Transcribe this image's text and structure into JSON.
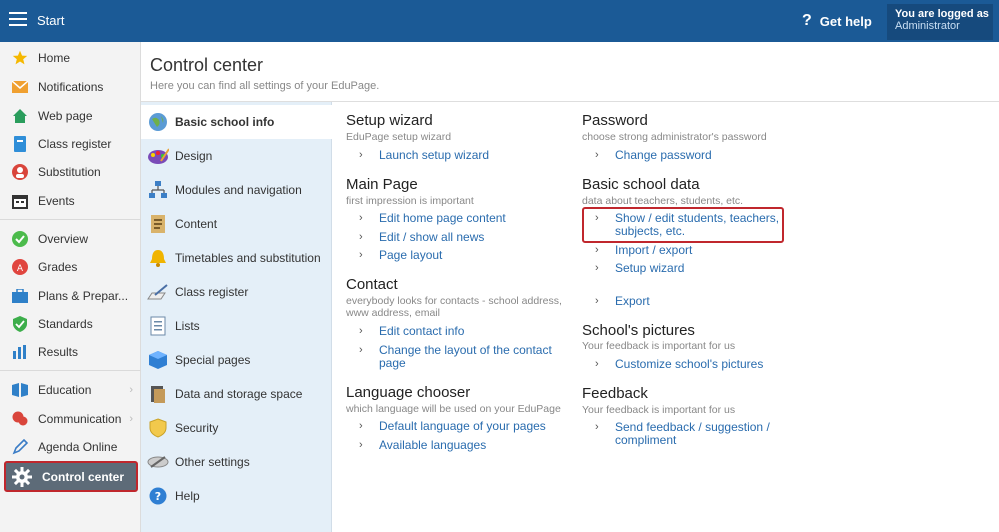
{
  "topbar": {
    "title": "Start",
    "help_label": "Get help",
    "login_line1": "You are logged as",
    "login_line2": "Administrator"
  },
  "sidebar": {
    "items": [
      {
        "label": "Home",
        "icon": "star-icon"
      },
      {
        "label": "Notifications",
        "icon": "envelope-icon"
      },
      {
        "label": "Web page",
        "icon": "house-icon"
      },
      {
        "label": "Class register",
        "icon": "book-icon"
      },
      {
        "label": "Substitution",
        "icon": "person-icon"
      },
      {
        "label": "Events",
        "icon": "calendar-icon"
      },
      {
        "label": "Overview",
        "icon": "check-circle-icon"
      },
      {
        "label": "Grades",
        "icon": "grade-icon"
      },
      {
        "label": "Plans & Prepar...",
        "icon": "briefcase-icon"
      },
      {
        "label": "Standards",
        "icon": "shield-check-icon"
      },
      {
        "label": "Results",
        "icon": "bar-chart-icon"
      },
      {
        "label": "Education",
        "icon": "book-open-icon"
      },
      {
        "label": "Communication",
        "icon": "chat-icon"
      },
      {
        "label": "Agenda Online",
        "icon": "pen-icon"
      },
      {
        "label": "Control center",
        "icon": "gear-icon"
      }
    ],
    "arrow": "›"
  },
  "header": {
    "title": "Control center",
    "subtitle": "Here you can find all settings of your EduPage."
  },
  "categories": [
    {
      "label": "Basic school info"
    },
    {
      "label": "Design"
    },
    {
      "label": "Modules and navigation"
    },
    {
      "label": "Content"
    },
    {
      "label": "Timetables and substitution"
    },
    {
      "label": "Class register"
    },
    {
      "label": "Lists"
    },
    {
      "label": "Special pages"
    },
    {
      "label": "Data and storage space"
    },
    {
      "label": "Security"
    },
    {
      "label": "Other settings"
    },
    {
      "label": "Help"
    }
  ],
  "sections": {
    "setup": {
      "title": "Setup wizard",
      "desc": "EduPage setup wizard",
      "links": [
        "Launch setup wizard"
      ]
    },
    "main": {
      "title": "Main Page",
      "desc": "first impression is important",
      "links": [
        "Edit home page content",
        "Edit / show all news",
        "Page layout"
      ]
    },
    "contact": {
      "title": "Contact",
      "desc1": "everybody looks for contacts - school address,",
      "desc2": "www address, email",
      "links": [
        "Edit contact info",
        "Change the layout of the contact",
        "page"
      ]
    },
    "language": {
      "title": "Language chooser",
      "desc": "which language will be used on your EduPage",
      "links": [
        "Default language of your pages",
        "Available languages"
      ]
    },
    "password": {
      "title": "Password",
      "desc": "choose strong administrator's password",
      "links": [
        "Change password"
      ]
    },
    "basic": {
      "title": "Basic school data",
      "desc": "data about teachers, students, etc.",
      "links": [
        "Show / edit students, teachers,",
        "subjects, etc.",
        "Import / export",
        "Setup wizard",
        "Export"
      ]
    },
    "pictures": {
      "title": "School's pictures",
      "desc": "Your feedback is important for us",
      "links": [
        "Customize school's pictures"
      ]
    },
    "feedback": {
      "title": "Feedback",
      "desc": "Your feedback is important for us",
      "links": [
        "Send feedback / suggestion /",
        "compliment"
      ]
    }
  },
  "chevron": "›"
}
